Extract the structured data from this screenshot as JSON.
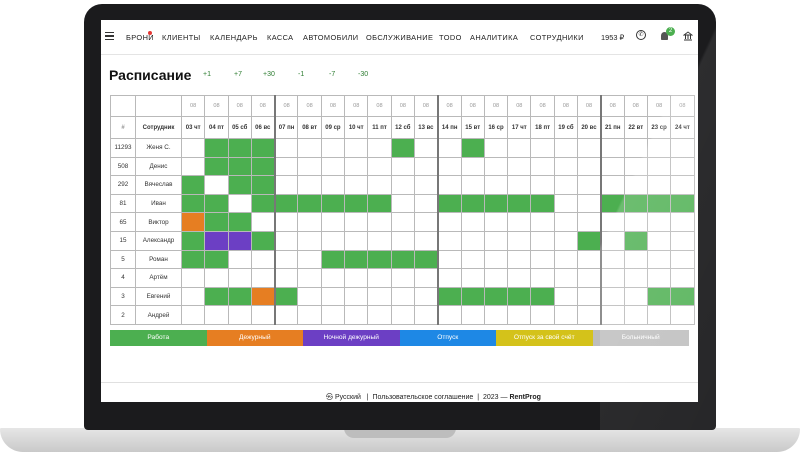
{
  "nav": {
    "items": [
      "БРОНИ",
      "КЛИЕНТЫ",
      "КАЛЕНДАРЬ",
      "КАССА",
      "АВТОМОБИЛИ",
      "ОБСЛУЖИВАНИЕ",
      "TODO",
      "АНАЛИТИКА",
      "СОТРУДНИКИ"
    ],
    "balance": "1953 ₽",
    "notifications": "2"
  },
  "page": {
    "title": "Расписание",
    "shifts": [
      "+1",
      "+7",
      "+30",
      "-1",
      "-7",
      "-30"
    ]
  },
  "table": {
    "header_num": "#",
    "header_employee": "Сотрудник",
    "month": "08",
    "days": [
      "03 чт",
      "04 пт",
      "05 сб",
      "06 вс",
      "07 пн",
      "08 вт",
      "09 ср",
      "10 чт",
      "11 пт",
      "12 сб",
      "13 вс",
      "14 пн",
      "15 вт",
      "16 ср",
      "17 чт",
      "18 пт",
      "19 сб",
      "20 вс",
      "21 пн",
      "22 вт",
      "23 ср",
      "24 чт"
    ],
    "rows": [
      {
        "id": "11293",
        "name": "Женя С.",
        "cells": "-GGG-----G--G---------"
      },
      {
        "id": "508",
        "name": "Денис",
        "cells": "-GGG------------------"
      },
      {
        "id": "292",
        "name": "Вячеслав",
        "cells": "G-GG------------------"
      },
      {
        "id": "81",
        "name": "Иван",
        "cells": "GG-GGGGGG--GGGGG--GGGG"
      },
      {
        "id": "65",
        "name": "Виктор",
        "cells": "OGG-------------------"
      },
      {
        "id": "15",
        "name": "Александр",
        "cells": "GPPG-------------G-G--"
      },
      {
        "id": "5",
        "name": "Роман",
        "cells": "GG----GGGGG-----------"
      },
      {
        "id": "4",
        "name": "Артём",
        "cells": "----------------------"
      },
      {
        "id": "3",
        "name": "Евгений",
        "cells": "-GGOG------GGGGG----GG"
      },
      {
        "id": "2",
        "name": "Андрей",
        "cells": "----------------------"
      }
    ]
  },
  "legend": [
    {
      "label": "Работа",
      "color": "#4caf50"
    },
    {
      "label": "Дежурный",
      "color": "#e67e22"
    },
    {
      "label": "Ночной дежурный",
      "color": "#6c3fc4"
    },
    {
      "label": "Отпуск",
      "color": "#1e88e5"
    },
    {
      "label": "Отпуск за свой счёт",
      "color": "#d4c21a"
    },
    {
      "label": "Больничный",
      "color": "#bdbdbd"
    }
  ],
  "footer": {
    "language": "Русский",
    "agreement": "Пользовательское соглашение",
    "year": "2023 —",
    "brand": "RentProg"
  }
}
